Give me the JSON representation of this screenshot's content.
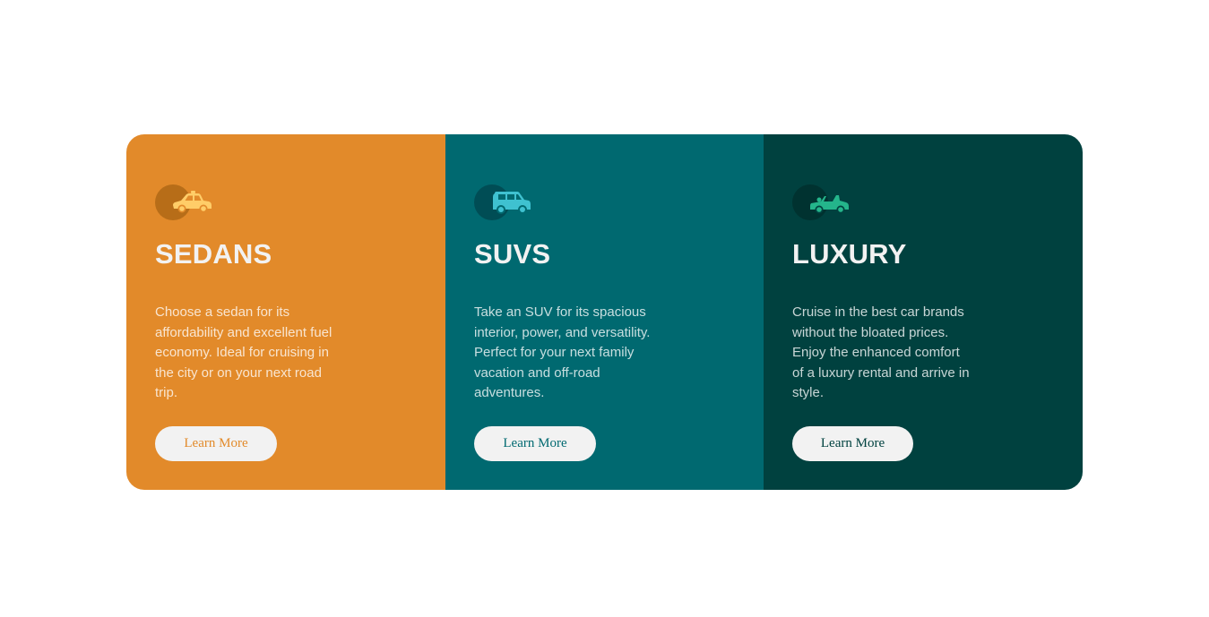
{
  "colors": {
    "sedans_bg": "#e28a2a",
    "suvs_bg": "#006970",
    "luxury_bg": "#00413f",
    "button_bg": "#f2f2f2",
    "heading": "#f2f2f2"
  },
  "cards": [
    {
      "icon": "sedan-car-icon",
      "title": "SEDANS",
      "description": "Choose a sedan for its affordability and excellent fuel economy. Ideal for cruising in the city or on your next road trip.",
      "button_label": "Learn More"
    },
    {
      "icon": "suv-car-icon",
      "title": "SUVS",
      "description": "Take an SUV for its spacious interior, power, and versatility. Perfect for your next family vacation and off-road adventures.",
      "button_label": "Learn More"
    },
    {
      "icon": "convertible-car-icon",
      "title": "LUXURY",
      "description": "Cruise in the best car brands without the bloated prices. Enjoy the enhanced comfort of a luxury rental and arrive in style.",
      "button_label": "Learn More"
    }
  ]
}
